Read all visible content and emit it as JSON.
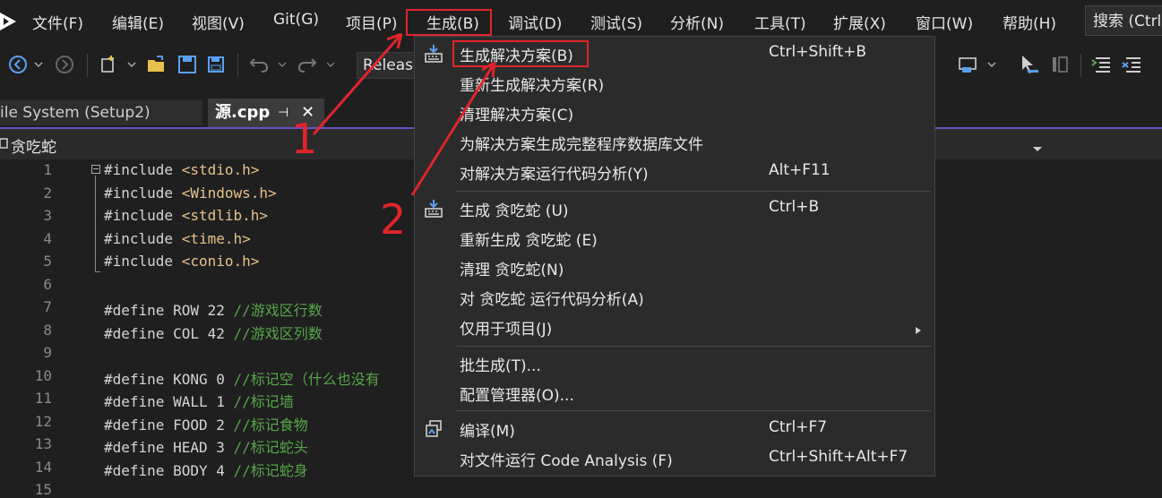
{
  "menubar": {
    "items": [
      "文件(F)",
      "编辑(E)",
      "视图(V)",
      "Git(G)",
      "项目(P)",
      "生成(B)",
      "调试(D)",
      "测试(S)",
      "分析(N)",
      "工具(T)",
      "扩展(X)",
      "窗口(W)",
      "帮助(H)"
    ],
    "search": "搜索 (Ctrl"
  },
  "toolbar": {
    "config": "Release"
  },
  "tabs": {
    "tab1": "ile System (Setup2)",
    "tab2": "源.cpp",
    "pin": "⊣",
    "close": "✕"
  },
  "navbar": {
    "scope": "贪吃蛇"
  },
  "editor": {
    "lines": [
      {
        "n": "1",
        "t": "#include <stdio.h>"
      },
      {
        "n": "2",
        "t": "#include <Windows.h>"
      },
      {
        "n": "3",
        "t": "#include <stdlib.h>"
      },
      {
        "n": "4",
        "t": "#include <time.h>"
      },
      {
        "n": "5",
        "t": "#include <conio.h>"
      },
      {
        "n": "6",
        "t": ""
      },
      {
        "n": "7",
        "t": "#define ROW 22 //游戏区行数"
      },
      {
        "n": "8",
        "t": "#define COL 42 //游戏区列数"
      },
      {
        "n": "9",
        "t": ""
      },
      {
        "n": "10",
        "t": "#define KONG 0 //标记空（什么也没有"
      },
      {
        "n": "11",
        "t": "#define WALL 1 //标记墙"
      },
      {
        "n": "12",
        "t": "#define FOOD 2 //标记食物"
      },
      {
        "n": "13",
        "t": "#define HEAD 3 //标记蛇头"
      },
      {
        "n": "14",
        "t": "#define BODY 4 //标记蛇身"
      },
      {
        "n": "15",
        "t": ""
      }
    ]
  },
  "dropdown": {
    "items": [
      {
        "label": "生成解决方案(B)",
        "shortcut": "Ctrl+Shift+B"
      },
      {
        "label": "重新生成解决方案(R)",
        "shortcut": ""
      },
      {
        "label": "清理解决方案(C)",
        "shortcut": ""
      },
      {
        "label": "为解决方案生成完整程序数据库文件",
        "shortcut": ""
      },
      {
        "label": "对解决方案运行代码分析(Y)",
        "shortcut": "Alt+F11"
      },
      {
        "label": "生成 贪吃蛇 (U)",
        "shortcut": "Ctrl+B"
      },
      {
        "label": "重新生成 贪吃蛇 (E)",
        "shortcut": ""
      },
      {
        "label": "清理 贪吃蛇(N)",
        "shortcut": ""
      },
      {
        "label": "对 贪吃蛇 运行代码分析(A)",
        "shortcut": ""
      },
      {
        "label": "仅用于项目(J)",
        "shortcut": ""
      },
      {
        "label": "批生成(T)...",
        "shortcut": ""
      },
      {
        "label": "配置管理器(O)...",
        "shortcut": ""
      },
      {
        "label": "编译(M)",
        "shortcut": "Ctrl+F7"
      },
      {
        "label": "对文件运行 Code Analysis (F)",
        "shortcut": "Ctrl+Shift+Alt+F7"
      }
    ]
  },
  "annotations": {
    "one": "1",
    "two": "2"
  },
  "colors": {
    "accent": "#6a4fc6",
    "annotation": "#e0252b",
    "comment": "#57a64a"
  }
}
